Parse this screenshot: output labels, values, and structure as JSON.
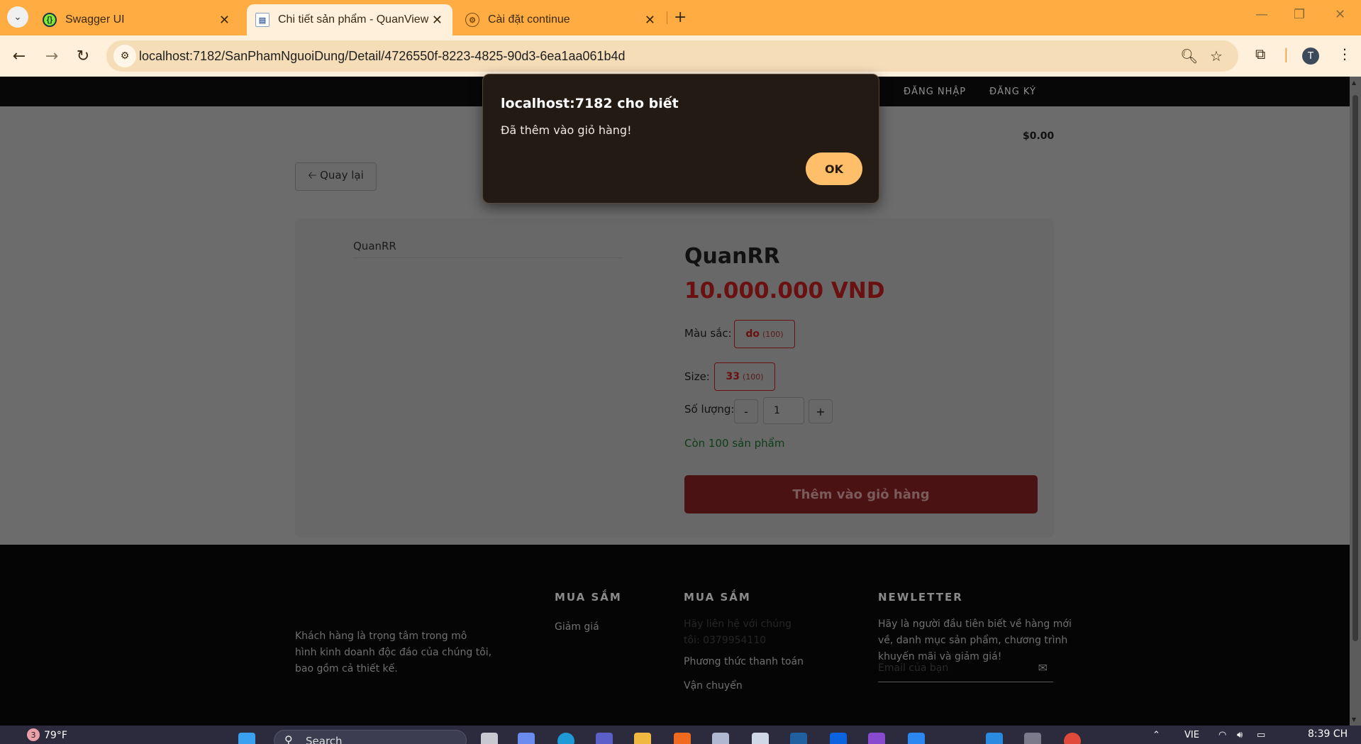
{
  "browser": {
    "tabs": [
      {
        "label": "Swagger UI",
        "active": false
      },
      {
        "label": "Chi tiết sản phẩm - QuanView",
        "active": true
      },
      {
        "label": "Cài đặt continue",
        "active": false
      }
    ],
    "url": "localhost:7182/SanPhamNguoiDung/Detail/4726550f-8223-4825-90d3-6ea1aa061b4d",
    "avatar_letter": "T"
  },
  "nav": {
    "login": "ĐĂNG NHẬP",
    "register": "ĐĂNG KÝ",
    "cart_total": "$0.00"
  },
  "back_button": "🡠 Quay lại",
  "product": {
    "image_alt": "QuanRR",
    "name": "QuanRR",
    "price": "10.000.000 VND",
    "color_label": "Màu sắc:",
    "color": {
      "value": "do",
      "count": "(100)"
    },
    "size_label": "Size:",
    "size": {
      "value": "33",
      "count": "(100)"
    },
    "qty_label": "Số lượng:",
    "qty_minus": "-",
    "qty_value": "1",
    "qty_plus": "+",
    "stock": "Còn 100 sản phẩm",
    "add_to_cart": "Thêm vào giỏ hàng"
  },
  "footer": {
    "about": [
      "Khách hàng là trọng tâm trong mô",
      "hình kinh doanh độc đáo của chúng tôi,",
      "bao gồm cả thiết kế."
    ],
    "col1_title": "MUA SẮM",
    "col1_links": [
      "Giảm giá"
    ],
    "col2_title": "MUA SẮM",
    "col2_faint": [
      "Hãy liên hệ với chúng",
      "tôi: 0379954110"
    ],
    "col2_links": [
      "Phương thức thanh toán",
      "Vận chuyển"
    ],
    "newsletter_title": "NEWLETTER",
    "newsletter_text": [
      "Hãy là người đầu tiên biết về hàng mới",
      "về, danh mục sản phẩm, chương trình",
      "khuyến mãi và giảm giá!"
    ],
    "email_placeholder": "Email của bạn"
  },
  "dialog": {
    "title": "localhost:7182 cho biết",
    "message": "Đã thêm vào giỏ hàng!",
    "ok": "OK"
  },
  "taskbar": {
    "weather": "79°F",
    "weather_badge": "3",
    "search": "Search",
    "lang": "VIE",
    "time": "8:39 CH"
  },
  "colors": {
    "tabbar": "#ffad43",
    "toolbar": "#fff0dc",
    "accent_red": "#6a1010",
    "dialog_ok": "#ffbe6a"
  }
}
